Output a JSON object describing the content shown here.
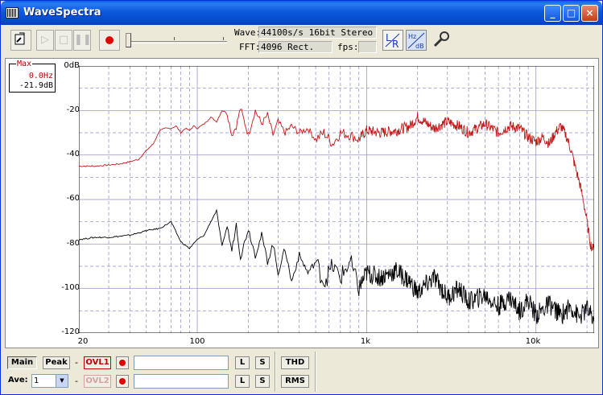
{
  "window": {
    "title": "WaveSpectra",
    "buttons": [
      "_",
      "□",
      "×"
    ]
  },
  "toolbar": {
    "wave_label": "Wave:",
    "wave_value": "44100s/s 16bit Stereo",
    "fft_label": "FFT:",
    "fft_value": "4096 Rect.",
    "fps_label": "fps:",
    "fps_value": "",
    "lr_label": "LR",
    "hzdb_label": "Hz dB"
  },
  "graph": {
    "max_label": "Max",
    "max_freq": "0.0Hz",
    "max_level": "-21.9dB",
    "y_ticks": [
      "0dB",
      "-20",
      "-40",
      "-60",
      "-80",
      "-100",
      "-120"
    ],
    "x_ticks": [
      "20",
      "100",
      "1k",
      "10k"
    ]
  },
  "bottom": {
    "main_label": "Main",
    "peak_label": "Peak",
    "ovl1_label": "OVL1",
    "ovl2_label": "OVL2",
    "ave_label": "Ave:",
    "ave_value": "1",
    "l_label": "L",
    "s_label": "S",
    "thd_label": "THD",
    "rms_label": "RMS",
    "dash": "-"
  },
  "colors": {
    "red_trace": "#c01818",
    "black_trace": "#000000",
    "grid": "#8a8ac8",
    "titlebar": "#0a5ee8"
  },
  "chart_data": {
    "type": "line",
    "xlabel": "",
    "ylabel": "",
    "x_scale": "log",
    "xlim": [
      20,
      22050
    ],
    "ylim": [
      -120,
      0
    ],
    "y_ticks": [
      0,
      -20,
      -40,
      -60,
      -80,
      -100,
      -120
    ],
    "x_ticks": [
      20,
      100,
      1000,
      10000
    ],
    "grid": true,
    "series": [
      {
        "x": [
          20,
          25,
          30,
          35,
          40,
          45,
          50,
          55,
          60,
          65,
          70,
          75,
          80,
          85,
          90,
          95,
          100,
          110,
          120,
          130,
          140,
          150,
          160,
          170,
          180,
          200,
          220,
          240,
          260,
          280,
          300,
          330,
          360,
          400,
          450,
          500,
          560,
          630,
          700,
          800,
          900,
          1000,
          1200,
          1500,
          1800,
          2000,
          2500,
          3000,
          3500,
          4000,
          5000,
          6000,
          7000,
          8000,
          9000,
          10000,
          11000,
          12000,
          13000,
          14000,
          15000,
          16000,
          17000,
          18000,
          19000,
          20000,
          21000,
          22000
        ],
        "y": [
          -45,
          -45,
          -44.5,
          -44,
          -43,
          -42,
          -38,
          -35,
          -29,
          -28,
          -28,
          -27,
          -30,
          -28,
          -29,
          -27,
          -28,
          -26,
          -23,
          -25,
          -20,
          -21,
          -31,
          -27,
          -19,
          -31,
          -20,
          -26,
          -22,
          -31,
          -25,
          -30,
          -27,
          -30,
          -28,
          -33,
          -30,
          -35,
          -30,
          -31,
          -33,
          -29,
          -30,
          -29,
          -27,
          -23,
          -28,
          -25,
          -27,
          -30,
          -26,
          -30,
          -27,
          -28,
          -32,
          -34,
          -32,
          -35,
          -30,
          -27,
          -31,
          -37,
          -45,
          -52,
          -60,
          -70,
          -80,
          -83
        ]
      },
      {
        "x": [
          20,
          25,
          30,
          35,
          40,
          45,
          50,
          60,
          70,
          80,
          90,
          100,
          110,
          120,
          130,
          140,
          150,
          160,
          170,
          180,
          200,
          220,
          240,
          260,
          280,
          300,
          330,
          360,
          400,
          450,
          500,
          560,
          630,
          700,
          800,
          900,
          1000,
          1200,
          1500,
          1800,
          2000,
          2500,
          3000,
          3500,
          4000,
          5000,
          6000,
          7000,
          8000,
          9000,
          10000,
          12000,
          14000,
          16000,
          18000,
          20000,
          22000
        ],
        "y": [
          -78,
          -77,
          -77,
          -76.5,
          -76,
          -75,
          -74,
          -73,
          -70,
          -79,
          -82,
          -78,
          -76,
          -70,
          -65,
          -81,
          -72,
          -83,
          -71,
          -86,
          -73,
          -85,
          -76,
          -88,
          -80,
          -93,
          -82,
          -97,
          -85,
          -93,
          -88,
          -97,
          -90,
          -95,
          -88,
          -100,
          -93,
          -95,
          -92,
          -97,
          -102,
          -95,
          -104,
          -100,
          -106,
          -103,
          -108,
          -104,
          -110,
          -105,
          -112,
          -107,
          -112,
          -108,
          -113,
          -109,
          -115
        ]
      }
    ]
  }
}
